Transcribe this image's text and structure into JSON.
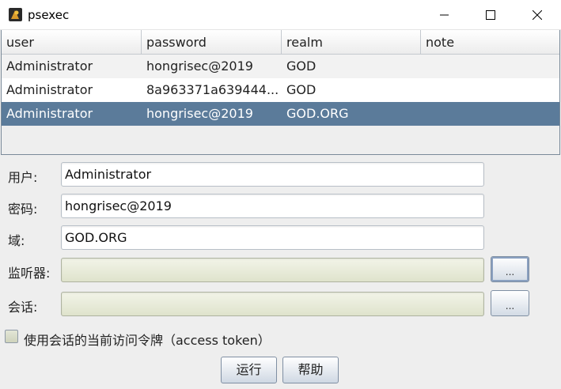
{
  "window": {
    "title": "psexec",
    "icon": "app-icon"
  },
  "table": {
    "columns": [
      "user",
      "password",
      "realm",
      "note"
    ],
    "rows": [
      {
        "user": "Administrator",
        "password": "hongrisec@2019",
        "realm": "GOD",
        "note": ""
      },
      {
        "user": "Administrator",
        "password": "8a963371a639444...",
        "realm": "GOD",
        "note": ""
      },
      {
        "user": "Administrator",
        "password": "hongrisec@2019",
        "realm": "GOD.ORG",
        "note": ""
      }
    ],
    "selected_row": 2
  },
  "form": {
    "user_label": "用户:",
    "user_value": "Administrator",
    "password_label": "密码:",
    "password_value": "hongrisec@2019",
    "domain_label": "域:",
    "domain_value": "GOD.ORG",
    "listener_label": "监听器:",
    "listener_value": "",
    "listener_button": "...",
    "session_label": "会话:",
    "session_value": "",
    "session_button": "..."
  },
  "checkbox": {
    "label": "使用会话的当前访问令牌（access token）",
    "checked": false
  },
  "buttons": {
    "run": "运行",
    "help": "帮助"
  },
  "colors": {
    "selected_row": "#5b7b9a",
    "disabled_field": "#e8ebd9"
  }
}
